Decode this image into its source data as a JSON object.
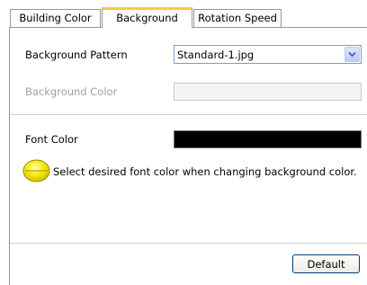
{
  "tabs": [
    {
      "label": "Building Color",
      "active": false
    },
    {
      "label": "Background",
      "active": true
    },
    {
      "label": "Rotation Speed",
      "active": false
    }
  ],
  "background": {
    "pattern_label": "Background Pattern",
    "pattern_value": "Standard-1.jpg",
    "color_label": "Background Color",
    "color_value": ""
  },
  "font": {
    "color_label": "Font Color",
    "color_value": "#000000"
  },
  "hint": {
    "icon": "yellow-circle-icon",
    "text": "Select desired font color when changing background color."
  },
  "footer": {
    "default_button": "Default"
  },
  "colors": {
    "active_tab_accent": "#ffc83c",
    "hint_icon": "#f5e400"
  }
}
